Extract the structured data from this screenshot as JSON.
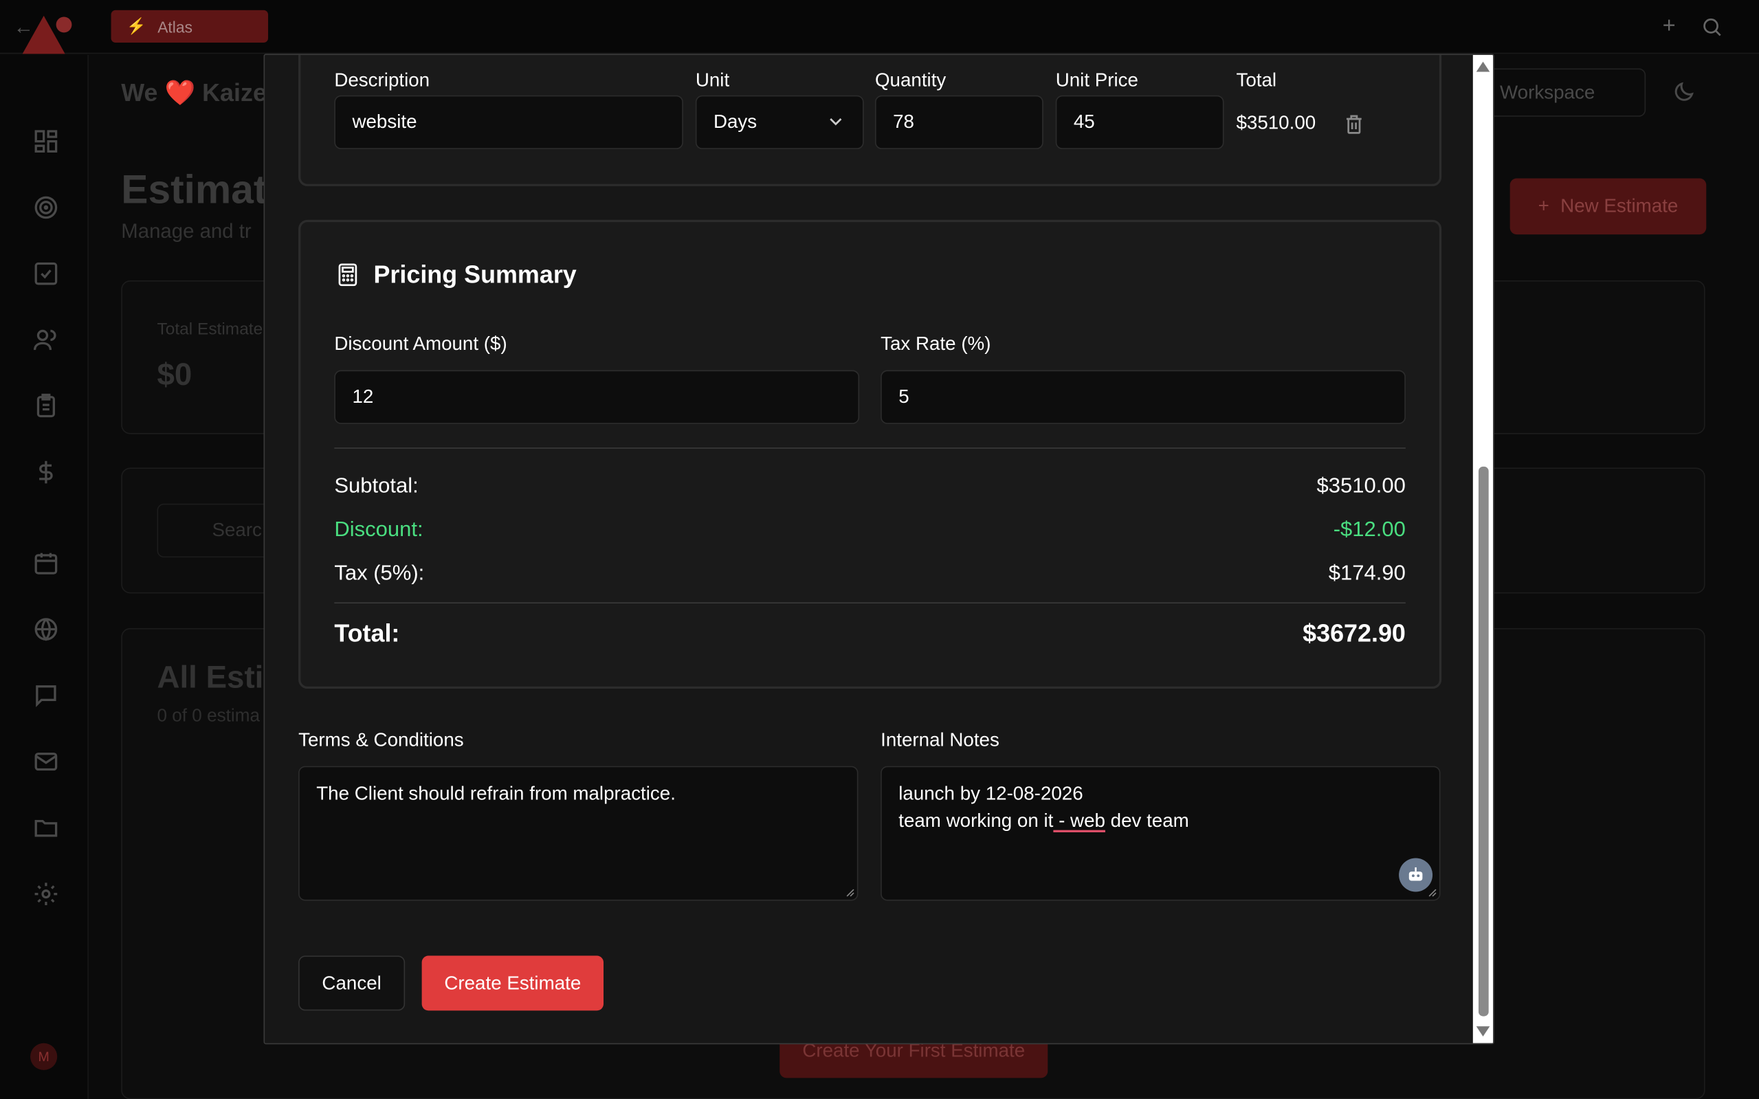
{
  "topbar": {
    "atlas_label": "Atlas"
  },
  "background": {
    "header_text": "We ❤️ Kaize",
    "workspace_label": "Workspace",
    "page_title": "Estimat",
    "page_subtitle": "Manage and tr",
    "new_estimate_label": "New Estimate",
    "total_estimates_label": "Total Estimate",
    "total_estimates_value": "$0",
    "search_placeholder": "Searc",
    "all_estimates_title": "All Esti",
    "all_estimates_sub": "0 of 0 estima",
    "create_first_label": "Create Your First Estimate",
    "avatar_initial": "M"
  },
  "line_items": {
    "headers": {
      "description": "Description",
      "unit": "Unit",
      "quantity": "Quantity",
      "unit_price": "Unit Price",
      "total": "Total"
    },
    "row": {
      "description": "website",
      "unit": "Days",
      "quantity": "78",
      "unit_price": "45",
      "total": "$3510.00"
    }
  },
  "pricing": {
    "title": "Pricing Summary",
    "discount_label": "Discount Amount ($)",
    "discount_value": "12",
    "tax_label": "Tax Rate (%)",
    "tax_value": "5",
    "subtotal_label": "Subtotal:",
    "subtotal_value": "$3510.00",
    "discount_row_label": "Discount:",
    "discount_row_value": "-$12.00",
    "tax_row_label": "Tax (5%):",
    "tax_row_value": "$174.90",
    "total_label": "Total:",
    "total_value": "$3672.90",
    "discount_color": "#4ade80"
  },
  "terms": {
    "label": "Terms & Conditions",
    "value": "The Client should refrain from malpractice."
  },
  "notes": {
    "label": "Internal Notes",
    "line1": "launch by 12-08-2026",
    "line2_a": "team working on it",
    "line2_b": " - web",
    "line2_c": " dev team"
  },
  "actions": {
    "cancel": "Cancel",
    "create": "Create Estimate",
    "accent": "#e03c3c"
  }
}
